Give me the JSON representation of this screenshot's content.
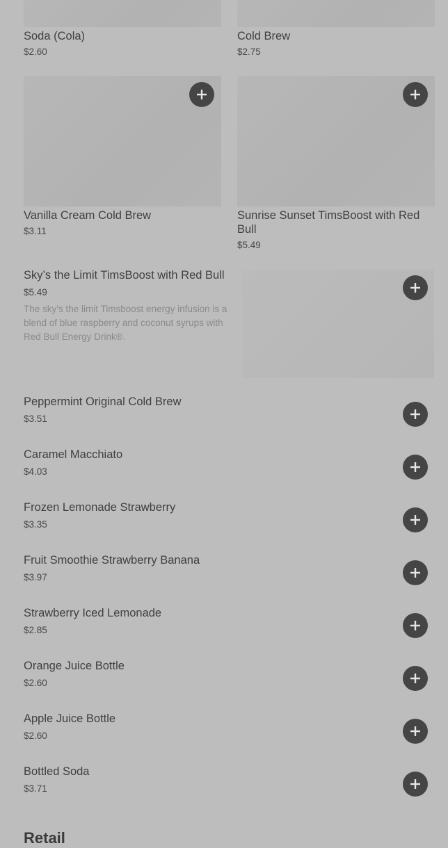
{
  "grid_items": [
    {
      "name": "Soda (Cola)",
      "price": "$2.60"
    },
    {
      "name": "Cold Brew",
      "price": "$2.75"
    },
    {
      "name": "Vanilla Cream Cold Brew",
      "price": "$3.11"
    },
    {
      "name": "Sunrise Sunset TimsBoost with Red Bull",
      "price": "$5.49"
    }
  ],
  "featured": {
    "name": "Sky’s the Limit TimsBoost with Red Bull",
    "price": "$5.49",
    "description": "The sky’s the limit Timsboost energy infusion is a blend of blue raspberry and coconut syrups with Red Bull Energy Drink®."
  },
  "list_items": [
    {
      "name": "Peppermint Original Cold Brew",
      "price": "$3.51"
    },
    {
      "name": "Caramel Macchiato",
      "price": "$4.03"
    },
    {
      "name": "Frozen Lemonade Strawberry",
      "price": "$3.35"
    },
    {
      "name": "Fruit Smoothie Strawberry Banana",
      "price": "$3.97"
    },
    {
      "name": "Strawberry Iced Lemonade",
      "price": "$2.85"
    },
    {
      "name": "Orange Juice Bottle",
      "price": "$2.60"
    },
    {
      "name": "Apple Juice Bottle",
      "price": "$2.60"
    },
    {
      "name": "Bottled Soda",
      "price": "$3.71"
    }
  ],
  "next_section": {
    "title": "Retail"
  },
  "icons": {
    "add": "plus-icon"
  },
  "colors": {
    "background": "#bdbdbd",
    "add_button": "#454545",
    "text": "#404040"
  }
}
